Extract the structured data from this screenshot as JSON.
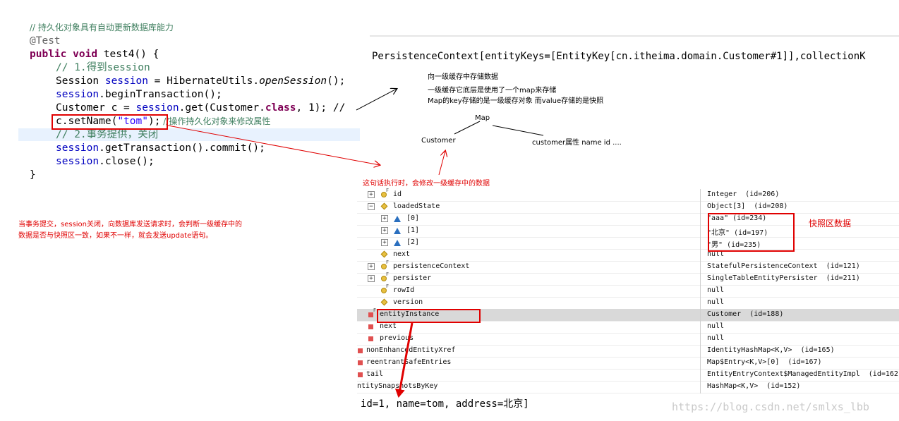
{
  "code": {
    "comment_persist": "// 持久化对象具有自动更新数据库能力",
    "annotation": "@Test",
    "kw_public": "public",
    "kw_void": "void",
    "method_sig": "test4() {",
    "comment_step1": "// 1.得到session",
    "line_session_a": "Session ",
    "line_session_field": "session",
    "line_session_b": " = HibernateUtils.",
    "line_session_call": "openSession",
    "line_session_c": "();",
    "line_begin_field": "session",
    "line_begin_rest": ".beginTransaction();",
    "line_get_a": "Customer c = ",
    "line_get_field": "session",
    "line_get_b": ".get(Customer.",
    "line_get_kw": "class",
    "line_get_c": ", 1); //",
    "line_set_a": "c.setName(",
    "line_set_str": "\"tom\"",
    "line_set_b": ");",
    "line_set_comment": " //操作持久化对象来修改属性",
    "comment_step2": "// 2.事务提供，关闭",
    "line_commit_field": "session",
    "line_commit_rest": ".getTransaction().commit();",
    "line_close_field": "session",
    "line_close_rest": ".close();",
    "closing_brace": "}"
  },
  "persistence_context_text": "PersistenceContext[entityKeys=[EntityKey[cn.itheima.domain.Customer#1]],collectionK",
  "notes": {
    "cache_title": "向一级缓存中存储数据",
    "cache_line1": "一级缓存它底层是使用了一个map来存储",
    "cache_line2": "Map的key存储的是一级缓存对象  而value存储的是快照",
    "map_label": "Map",
    "customer_label": "Customer",
    "customer_attrs": "customer属性  name  id  ....",
    "modify_note": "这句话执行时，会修改一级缓存中的数据",
    "commit_note_line1": "当事务提交，session关闭，向数据库发送请求时，会判断一级缓存中的",
    "commit_note_line2": "数据是否与快照区一致，如果不一样，就会发送update语句。",
    "snapshot_label": "快照区数据"
  },
  "debugger": {
    "rows": [
      {
        "name": "id",
        "value": "Integer  (id=206)"
      },
      {
        "name": "loadedState",
        "value": "Object[3]  (id=208)"
      },
      {
        "name": "[0]",
        "value": "\"aaa\" (id=234)"
      },
      {
        "name": "[1]",
        "value": "\"北京\" (id=197)"
      },
      {
        "name": "[2]",
        "value": "\"男\" (id=235)"
      },
      {
        "name": "next",
        "value": "null"
      },
      {
        "name": "persistenceContext",
        "value": "StatefulPersistenceContext  (id=121)"
      },
      {
        "name": "persister",
        "value": "SingleTableEntityPersister  (id=211)"
      },
      {
        "name": "rowId",
        "value": "null"
      },
      {
        "name": "version",
        "value": "null"
      },
      {
        "name": "entityInstance",
        "value": "Customer  (id=188)"
      },
      {
        "name": "next",
        "value": "null"
      },
      {
        "name": "previous",
        "value": "null"
      },
      {
        "name": "nonEnhancedEntityXref",
        "value": "IdentityHashMap<K,V>  (id=165)"
      },
      {
        "name": "reentrantSafeEntries",
        "value": "Map$Entry<K,V>[0]  (id=167)"
      },
      {
        "name": "tail",
        "value": "EntityEntryContext$ManagedEntityImpl  (id=162"
      },
      {
        "name": "entitySnapshotsByKey",
        "value": "HashMap<K,V>  (id=152)"
      }
    ],
    "detail_text": "id=1, name=tom, address=北京]"
  },
  "watermark": "https://blog.csdn.net/smlxs_lbb",
  "colors": {
    "annotation_red": "#e00000",
    "keyword": "#7f0055",
    "comment": "#3f7f5f",
    "string": "#2a00ff",
    "field": "#0000c0"
  }
}
